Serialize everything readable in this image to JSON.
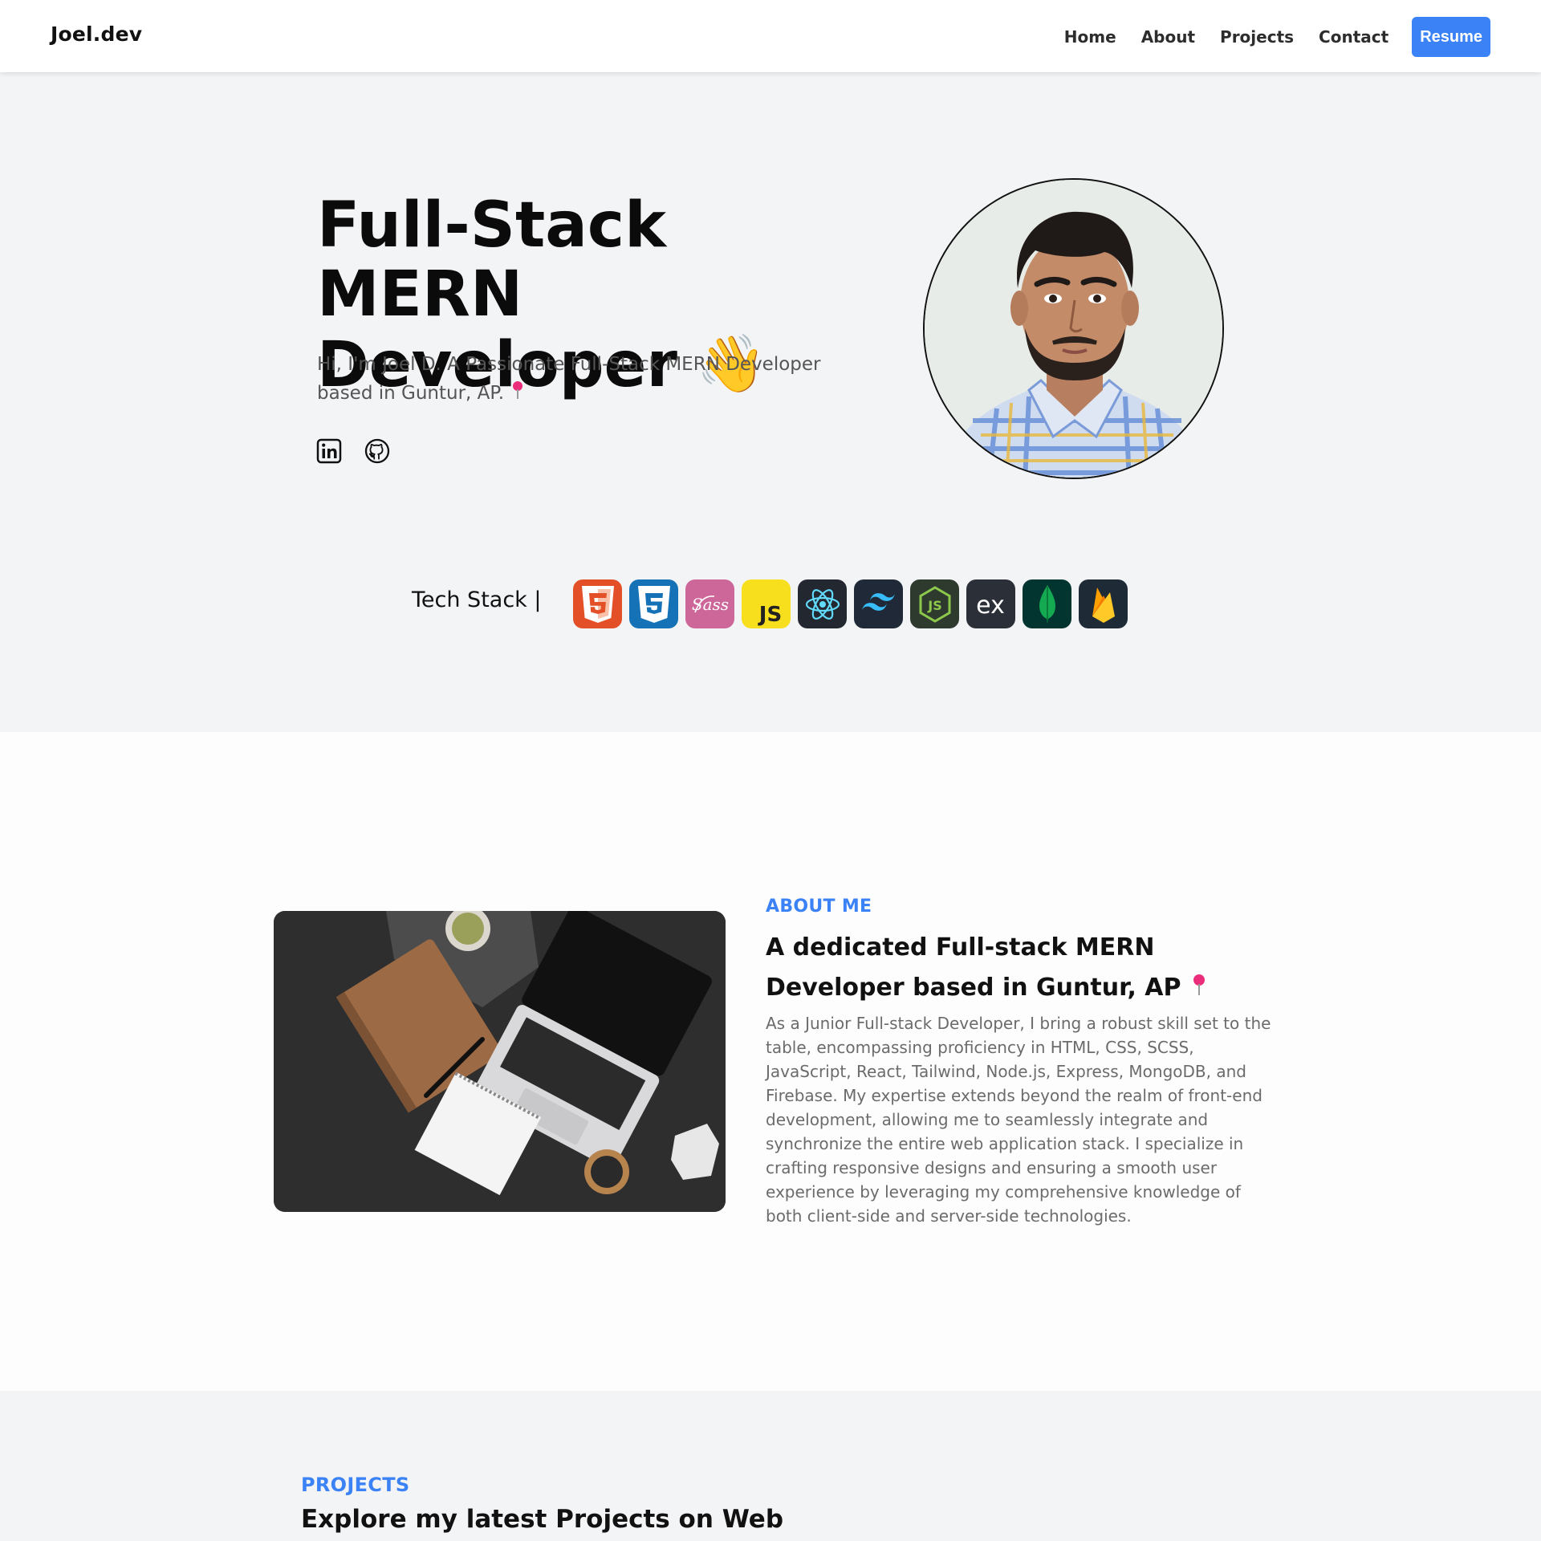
{
  "nav": {
    "brand": "Joel.dev",
    "links": [
      "Home",
      "About",
      "Projects",
      "Contact"
    ],
    "resume_label": "Resume"
  },
  "hero": {
    "title_line1": "Full-Stack MERN",
    "title_line2": "Developer",
    "wave_emoji": "👋",
    "subtitle": "Hi, I'm Joel D. A Passionate Full-Stack MERN Developer based in Guntur, AP.",
    "socials": [
      "linkedin-icon",
      "github-icon"
    ],
    "photo_alt": "profile-photo"
  },
  "tech_stack": {
    "label": "Tech Stack |",
    "items": [
      "html5-icon",
      "css3-icon",
      "sass-icon",
      "javascript-icon",
      "react-icon",
      "tailwind-icon",
      "nodejs-icon",
      "express-icon",
      "mongodb-icon",
      "firebase-icon"
    ]
  },
  "about": {
    "eyebrow": "ABOUT ME",
    "heading": "A dedicated Full-stack MERN Developer based in Guntur, AP",
    "text": "As a Junior Full-stack Developer, I bring a robust skill set to the table, encompassing proficiency in HTML, CSS, SCSS, JavaScript, React, Tailwind, Node.js, Express, MongoDB, and Firebase. My expertise extends beyond the realm of front-end development, allowing me to seamlessly integrate and synchronize the entire web application stack. I specialize in crafting responsive designs and ensuring a smooth user experience by leveraging my comprehensive knowledge of both client-side and server-side technologies."
  },
  "projects": {
    "eyebrow": "PROJECTS",
    "heading": "Explore my latest Projects on Web"
  },
  "colors": {
    "accent": "#3b82f6",
    "hero_bg": "#f3f4f6",
    "pin": "#ec2d7b"
  }
}
